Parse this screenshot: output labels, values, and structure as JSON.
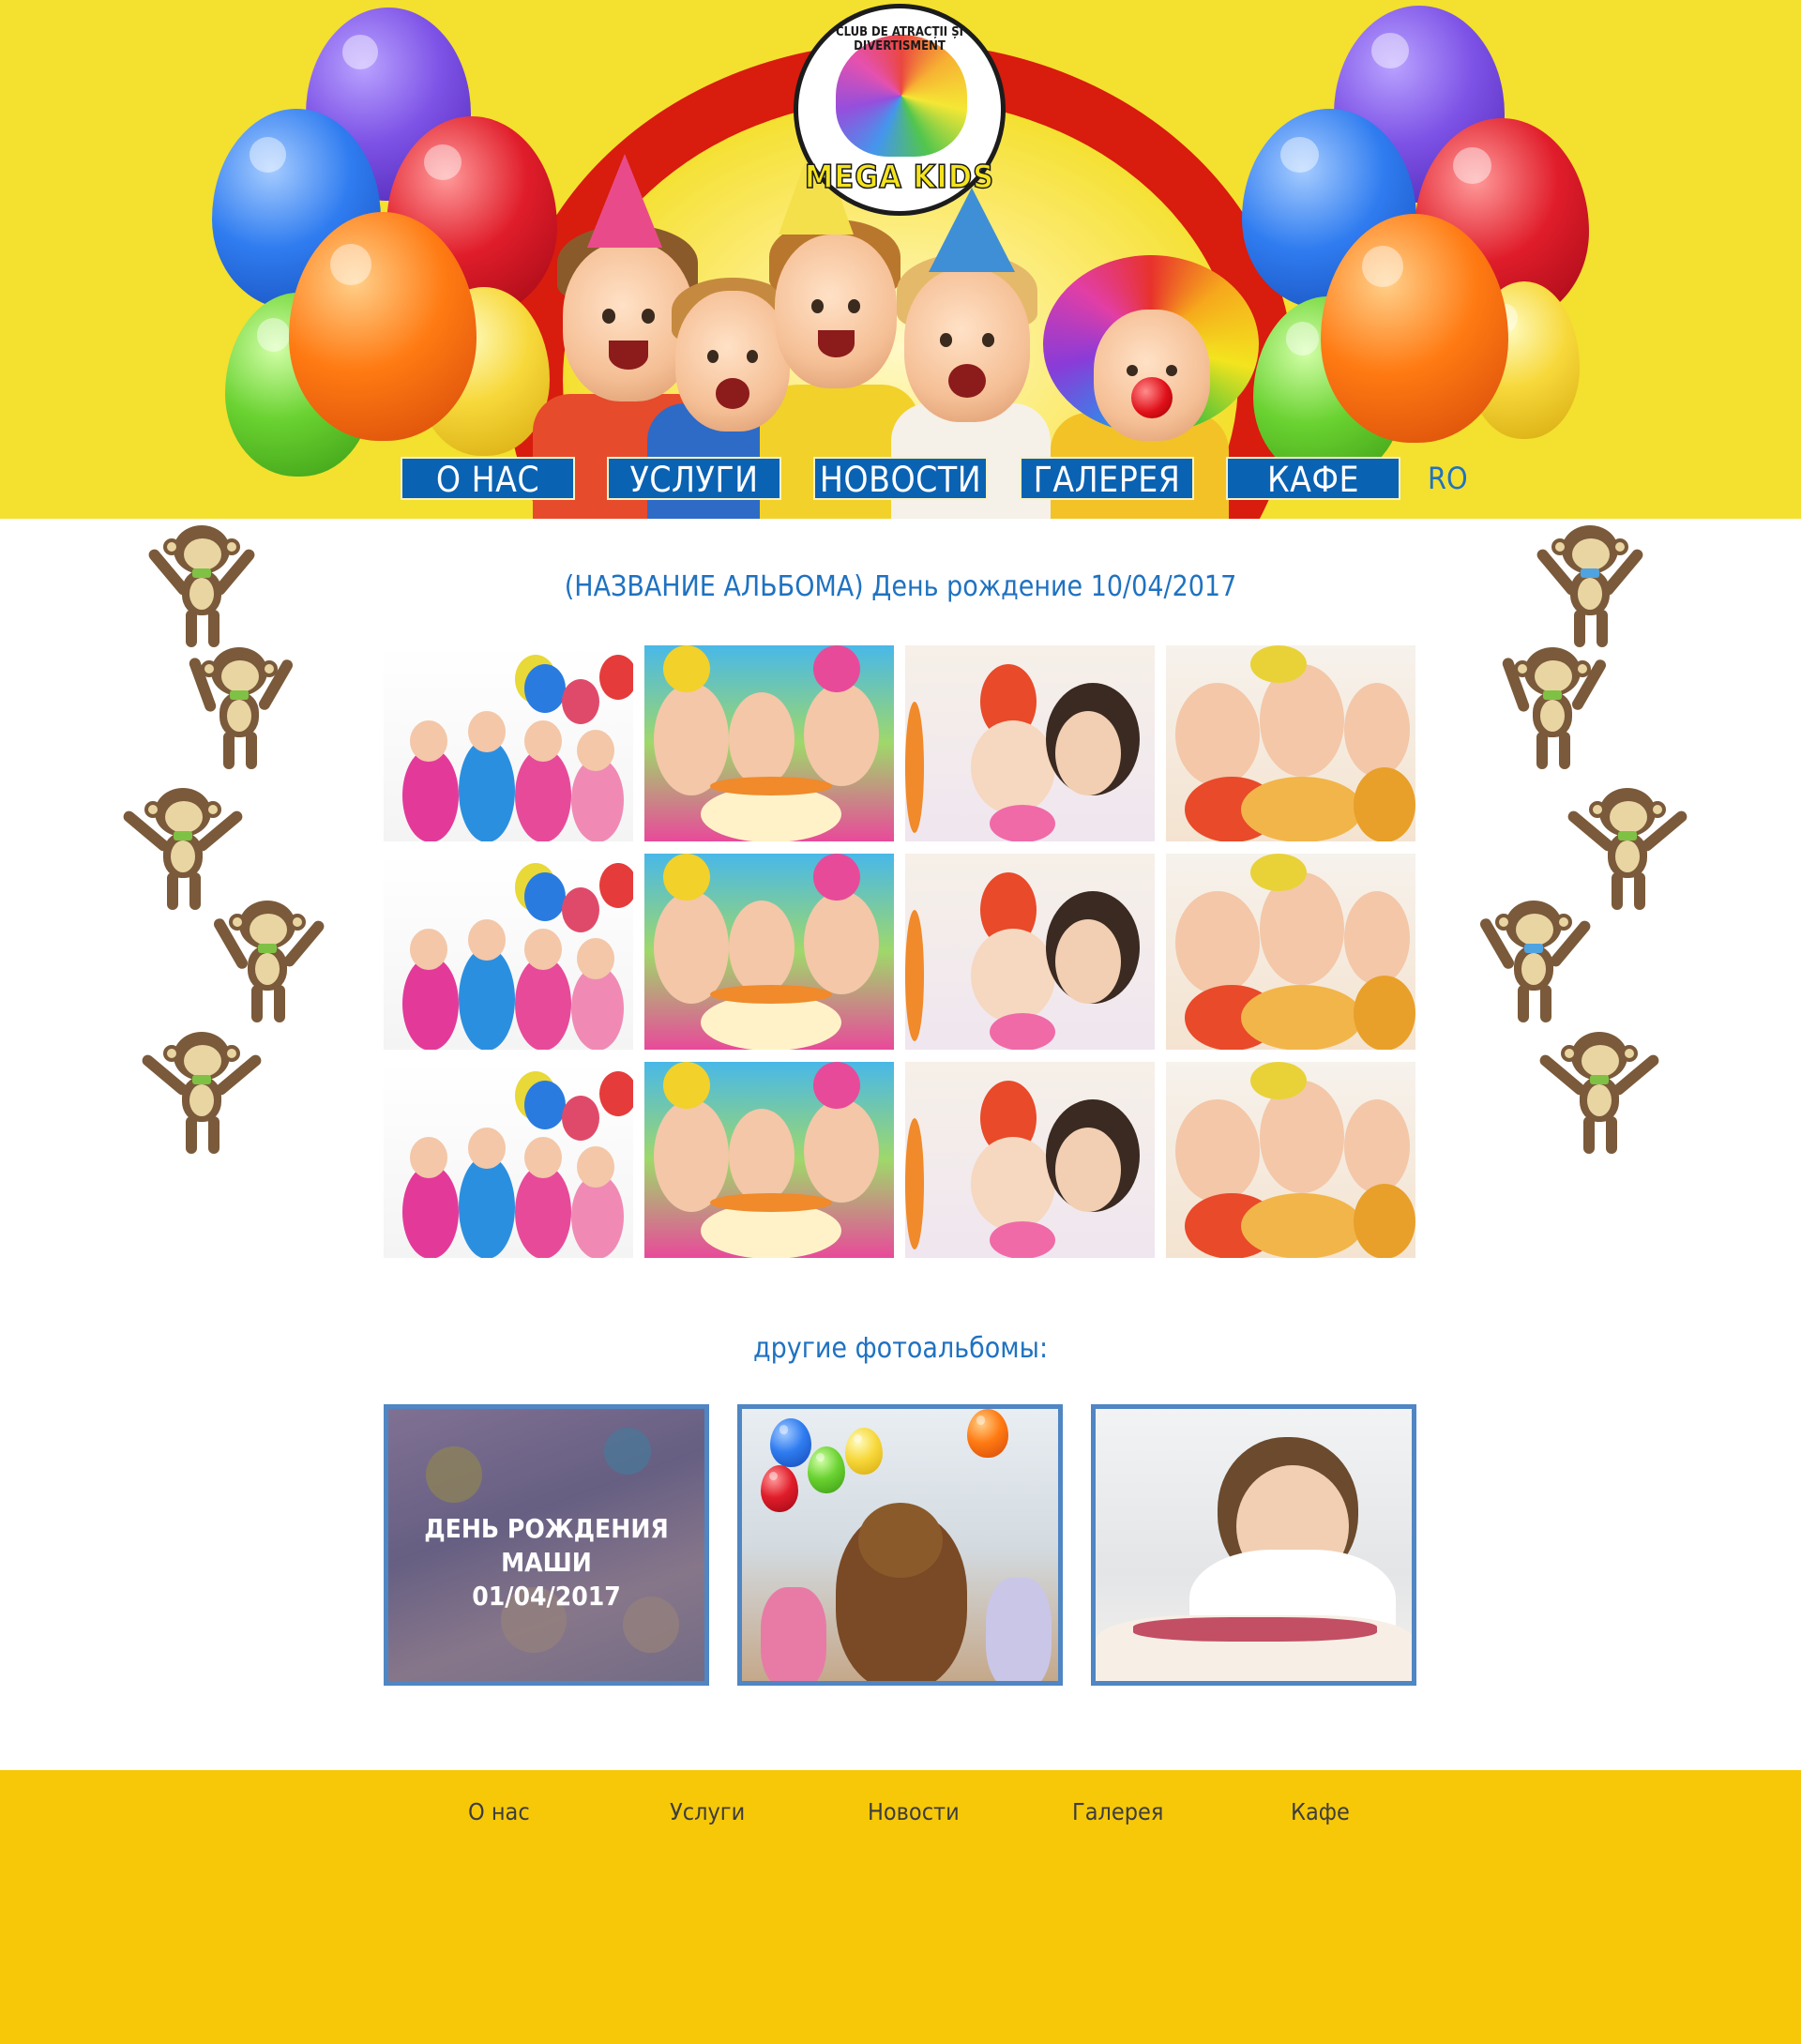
{
  "header": {
    "logo": {
      "top_text": "CLUB DE ATRACȚII ȘI DIVERTISMENT",
      "name": "MEGA KIDS"
    },
    "nav": [
      {
        "label": "О НАС"
      },
      {
        "label": "УСЛУГИ"
      },
      {
        "label": "НОВОСТИ"
      },
      {
        "label": "ГАЛЕРЕЯ"
      },
      {
        "label": "КАФЕ"
      }
    ],
    "language": "RO"
  },
  "album": {
    "title": "(НАЗВАНИЕ АЛЬБОМА) День рождение 10/04/2017",
    "photo_rows": 3,
    "photo_cols": 4
  },
  "other_albums": {
    "title": "другие фотоальбомы:",
    "items": [
      {
        "label_line1": "ДЕНЬ РОЖДЕНИЯ МАШИ",
        "label_line2": "01/04/2017"
      },
      {
        "label_line1": "",
        "label_line2": ""
      },
      {
        "label_line1": "",
        "label_line2": ""
      }
    ]
  },
  "footer": {
    "links": [
      {
        "label": "О нас"
      },
      {
        "label": "Услуги"
      },
      {
        "label": "Новости"
      },
      {
        "label": "Галерея"
      },
      {
        "label": "Кафе"
      }
    ]
  },
  "colors": {
    "header_bg": "#f4e02f",
    "nav_button": "#0a62b3",
    "title_blue": "#1f72c1",
    "card_border": "#4f86c3",
    "footer_bg": "#f7c808"
  }
}
